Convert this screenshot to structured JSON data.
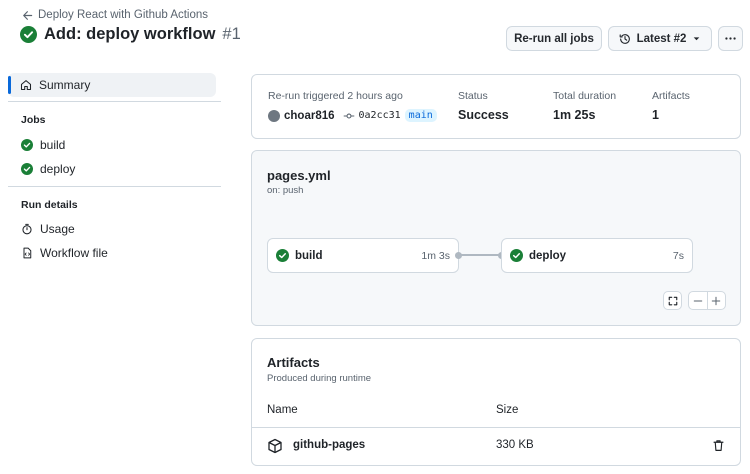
{
  "header": {
    "back_label": "Deploy React with Github Actions",
    "title": "Add: deploy workflow",
    "run_number": "#1",
    "rerun_label": "Re-run all jobs",
    "latest_label": "Latest #2"
  },
  "sidebar": {
    "summary_label": "Summary",
    "jobs_heading": "Jobs",
    "jobs": [
      {
        "label": "build"
      },
      {
        "label": "deploy"
      }
    ],
    "run_details_heading": "Run details",
    "details": [
      {
        "label": "Usage"
      },
      {
        "label": "Workflow file"
      }
    ]
  },
  "run_summary": {
    "trigger_text": "Re-run triggered 2 hours ago",
    "actor": "choar816",
    "commit": "0a2cc31",
    "branch": "main",
    "status_label": "Status",
    "status_value": "Success",
    "duration_label": "Total duration",
    "duration_value": "1m 25s",
    "artifacts_label": "Artifacts",
    "artifacts_value": "1"
  },
  "graph": {
    "file": "pages.yml",
    "trigger": "on: push",
    "jobs": [
      {
        "name": "build",
        "duration": "1m 3s"
      },
      {
        "name": "deploy",
        "duration": "7s"
      }
    ]
  },
  "artifacts": {
    "title": "Artifacts",
    "subtitle": "Produced during runtime",
    "col_name": "Name",
    "col_size": "Size",
    "items": [
      {
        "name": "github-pages",
        "size": "330 KB"
      }
    ]
  },
  "colors": {
    "success": "#1a7f37",
    "accent": "#0969da"
  }
}
